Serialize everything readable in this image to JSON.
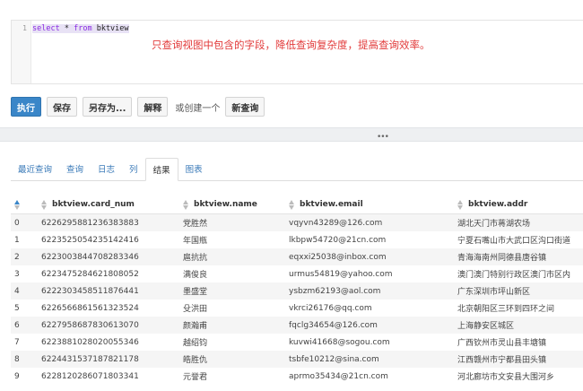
{
  "editor": {
    "line_number": "1",
    "code_keyword1": "select",
    "code_star": "*",
    "code_keyword2": "from",
    "code_table": "bktview",
    "annotation": "只查询视图中包含的字段，降低查询复杂度，提高查询效率。"
  },
  "toolbar": {
    "execute": "执行",
    "save": "保存",
    "save_as": "另存为...",
    "explain": "解释",
    "or_create": "或创建一个",
    "new_query": "新查询"
  },
  "splitter": {
    "grip": "•••"
  },
  "tabs": [
    {
      "label": "最近查询"
    },
    {
      "label": "查询"
    },
    {
      "label": "日志"
    },
    {
      "label": "列"
    },
    {
      "label": "结果",
      "active": true
    },
    {
      "label": "图表"
    }
  ],
  "table": {
    "columns": [
      "bktview.card_num",
      "bktview.name",
      "bktview.email",
      "bktview.addr"
    ],
    "rows": [
      {
        "idx": "0",
        "card_num": "6226295881236383883",
        "name": "党胜然",
        "email": "vqyvn43289@126.com",
        "addr": "湖北天门市蒋湖农场"
      },
      {
        "idx": "1",
        "card_num": "6223525054235142416",
        "name": "年国瓶",
        "email": "lkbpw54720@21cn.com",
        "addr": "宁夏石嘴山市大武口区沟口街道"
      },
      {
        "idx": "2",
        "card_num": "6223003844708283346",
        "name": "扈抗抗",
        "email": "eqxxi25038@inbox.com",
        "addr": "青海海南州同德县唐谷镇"
      },
      {
        "idx": "3",
        "card_num": "6223475284621808052",
        "name": "满俊良",
        "email": "urmus54819@yahoo.com",
        "addr": "澳门澳门特别行政区澳门市区内"
      },
      {
        "idx": "4",
        "card_num": "6222303458511876441",
        "name": "墨盛堂",
        "email": "ysbzm62193@aol.com",
        "addr": "广东深圳市坪山新区"
      },
      {
        "idx": "5",
        "card_num": "6226566861561323524",
        "name": "殳洪田",
        "email": "vkrci26176@qq.com",
        "addr": "北京朝阳区三环到四环之间"
      },
      {
        "idx": "6",
        "card_num": "6227958687830613070",
        "name": "颜瀚甫",
        "email": "fqclg34654@126.com",
        "addr": "上海静安区城区"
      },
      {
        "idx": "7",
        "card_num": "6223881028020055346",
        "name": "越绍钧",
        "email": "kuvwi41668@sogou.com",
        "addr": "广西钦州市灵山县丰塘镇"
      },
      {
        "idx": "8",
        "card_num": "6224431537187821178",
        "name": "皓胜仇",
        "email": "tsbfe10212@sina.com",
        "addr": "江西赣州市宁都县田头镇"
      },
      {
        "idx": "9",
        "card_num": "6228120286071803341",
        "name": "元誉君",
        "email": "aprmo35434@21cn.com",
        "addr": "河北廊坊市文安县大围河乡"
      }
    ]
  }
}
